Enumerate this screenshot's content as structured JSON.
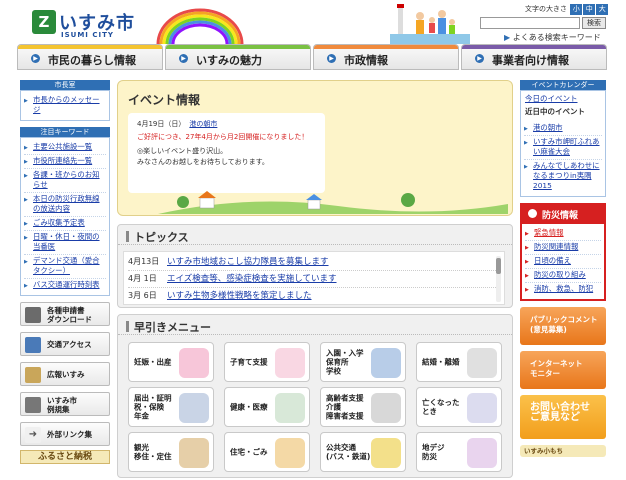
{
  "header": {
    "logo_name": "いすみ市",
    "logo_en": "ISUMI CITY",
    "font_size_label": "文字の大きさ",
    "font_sizes": [
      "小",
      "中",
      "大"
    ],
    "search_button": "検索",
    "faq_link": "よくある検索キーワード"
  },
  "nav": [
    {
      "label": "市民の暮らし情報",
      "color": "#f4c430"
    },
    {
      "label": "いすみの魅力",
      "color": "#7ac143"
    },
    {
      "label": "市政情報",
      "color": "#f08a3c"
    },
    {
      "label": "事業者向け情報",
      "color": "#7a5ba8"
    }
  ],
  "left": {
    "mayor_head": "市長室",
    "mayor_items": [
      "市長からのメッセージ"
    ],
    "keyword_head": "注目キーワード",
    "keyword_items": [
      "主要公共施設一覧",
      "市役所連絡先一覧",
      "各課・班からのお知らせ",
      "本日の防災行政無線の放送内容",
      "ごみ収集予定表",
      "日曜・休日・夜間の当番医",
      "デマンド交通（愛合タクシー）",
      "バス交通運行時刻表"
    ],
    "buttons": [
      {
        "label_1": "各種申請書",
        "label_2": "ダウンロード"
      },
      {
        "label_1": "交通アクセス",
        "label_2": ""
      },
      {
        "label_1": "広報いすみ",
        "label_2": ""
      },
      {
        "label_1": "いすみ市",
        "label_2": "例規集"
      },
      {
        "label_1": "外部リンク集",
        "label_2": ""
      }
    ],
    "furusato": "ふるさと納税"
  },
  "event": {
    "title": "イベント情報",
    "date": "4月19日（日）",
    "link": "港の朝市",
    "notice": "ご好評につき、27年4月から月2回開催になりました！",
    "desc_1": "◎楽しいイベント盛り沢山。",
    "desc_2": "みなさんのお越しをお待ちしております。"
  },
  "topics": {
    "title": "トピックス",
    "items": [
      {
        "date": "4月13日",
        "text": "いすみ市地域おこし協力隊員を募集します"
      },
      {
        "date": "4月 1日",
        "text": "エイズ検査等、感染症検査を実施しています"
      },
      {
        "date": "3月 6日",
        "text": "いすみ生物多様性戦略を策定しました"
      }
    ]
  },
  "menu": {
    "title": "早引きメニュー",
    "items": [
      {
        "label": "妊娠・出産",
        "color": "#f7c6d9"
      },
      {
        "label": "子育て支援",
        "color": "#f9d7e3"
      },
      {
        "label": "入園・入学\n保育所\n学校",
        "color": "#b8cde8"
      },
      {
        "label": "結婚・離婚",
        "color": "#e0e0e0"
      },
      {
        "label": "届出・証明\n税・保険\n年金",
        "color": "#c9d4e6"
      },
      {
        "label": "健康・医療",
        "color": "#d8e8d8"
      },
      {
        "label": "高齢者支援\n介護\n障害者支援",
        "color": "#d8d8d8"
      },
      {
        "label": "亡くなった\nとき",
        "color": "#dcdcef"
      },
      {
        "label": "観光\n移住・定住",
        "color": "#e6cfa8"
      },
      {
        "label": "住宅・ごみ",
        "color": "#f4d9a6"
      },
      {
        "label": "公共交通\n(バス・鉄道)",
        "color": "#f3e08a"
      },
      {
        "label": "地デジ\n防災",
        "color": "#e9d4ee"
      }
    ]
  },
  "right": {
    "calendar_head": "イベントカレンダー",
    "today_link": "今日のイベント",
    "ongoing": "近日中のイベント",
    "calendar_items": [
      "港の朝市",
      "いすみ市岬町ふれあい麻雀大会",
      "みんなでしあわせになるまつりin夷隅2015"
    ],
    "disaster_head": "防災情報",
    "disaster_items": [
      "緊急情報",
      "防災関連情報",
      "日頃の備え",
      "防災の取り組み",
      "消防、救急、防犯"
    ],
    "banner_comment_1": "パブリックコメント",
    "banner_comment_2": "(意見募集)",
    "banner_monitor_1": "インターネット",
    "banner_monitor_2": "モニター",
    "banner_question_1": "お問い合わせ",
    "banner_question_2": "ご意見など",
    "banner_last": "いすみ小もち"
  }
}
